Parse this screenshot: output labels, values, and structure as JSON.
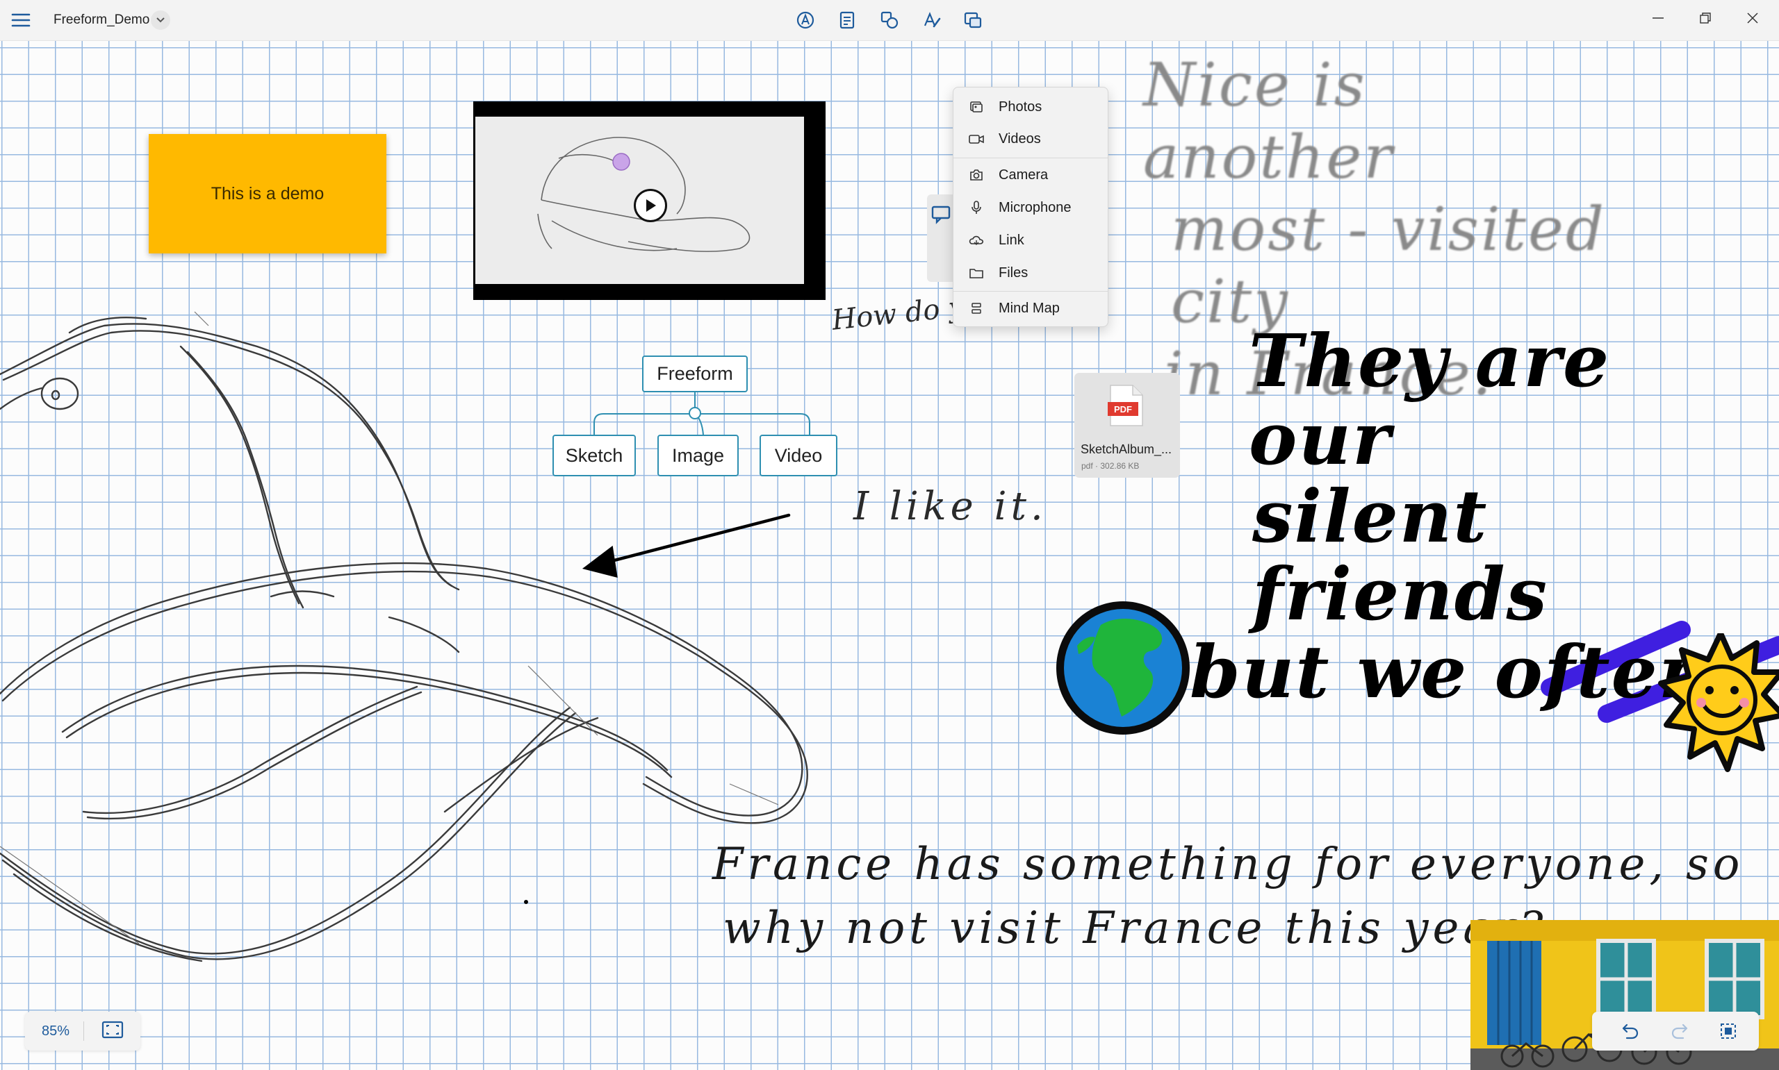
{
  "app": {
    "doc_title": "Freeform_Demo"
  },
  "toolbar": {
    "center_tools": [
      "pen-tool-icon",
      "notes-icon",
      "shapes-icon",
      "text-icon",
      "insert-media-icon"
    ],
    "window_controls": [
      "minimize",
      "restore",
      "close"
    ]
  },
  "canvas": {
    "sticky_note": {
      "text": "This is a demo",
      "color": "#FFB900"
    },
    "video": {
      "thumbnail": "cap-sketch"
    },
    "mind_map": {
      "root": "Freeform",
      "children": [
        "Sketch",
        "Image",
        "Video"
      ]
    },
    "pdf": {
      "name": "SketchAlbum_...",
      "type": "pdf",
      "size": "302.86 KB"
    },
    "handwriting": {
      "nice": [
        "Nice is another",
        "most - visited city",
        "in France."
      ],
      "how": "How do you like it?",
      "like": "I like it.",
      "friends": [
        "They are our",
        "silent friends",
        "but we often"
      ],
      "france": [
        "France has something for everyone, so",
        "why not visit France this year?"
      ]
    }
  },
  "insert_menu": {
    "items": [
      {
        "label": "Photos",
        "icon": "photo-icon"
      },
      {
        "label": "Videos",
        "icon": "video-icon"
      },
      {
        "label": "Camera",
        "icon": "camera-icon"
      },
      {
        "label": "Microphone",
        "icon": "microphone-icon"
      },
      {
        "label": "Link",
        "icon": "link-icon"
      },
      {
        "label": "Files",
        "icon": "folder-icon"
      },
      {
        "label": "Mind Map",
        "icon": "mind-map-icon"
      }
    ]
  },
  "status": {
    "zoom": "85%"
  },
  "colors": {
    "accent": "#1E5B9C",
    "grid": "#97B9E0",
    "mind_map_border": "#2E8FB1",
    "ink_blue_stroke": "#3F1FE0"
  }
}
